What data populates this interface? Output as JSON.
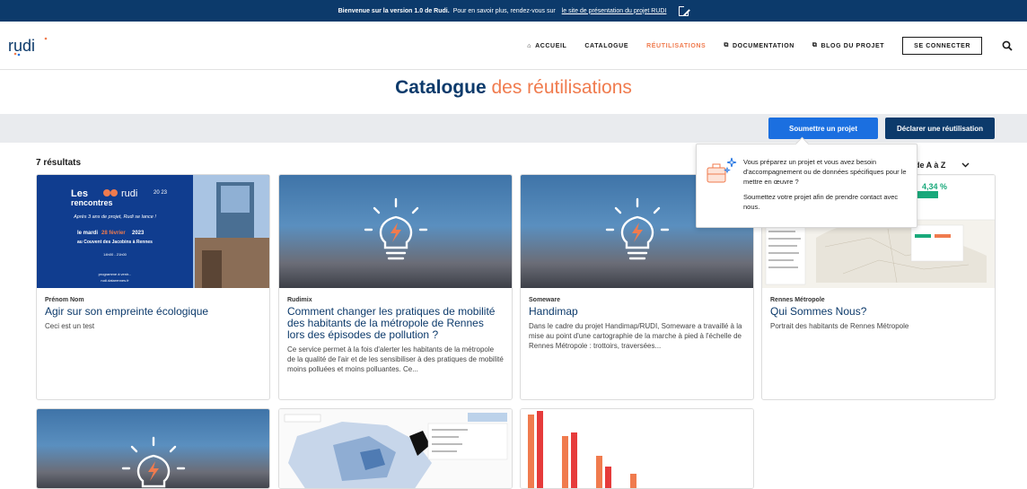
{
  "banner": {
    "bold_text": "Bienvenue sur la version 1.0 de Rudi.",
    "text": "Pour en savoir plus, rendez-vous sur",
    "link_text": "le site de présentation du projet RUDI"
  },
  "nav": {
    "logo_text": "rudi",
    "items": [
      {
        "label": "ACCUEIL",
        "icon": "home-icon"
      },
      {
        "label": "CATALOGUE",
        "icon": ""
      },
      {
        "label": "RÉUTILISATIONS",
        "icon": ""
      },
      {
        "label": "DOCUMENTATION",
        "icon": "external-link-icon"
      },
      {
        "label": "BLOG DU PROJET",
        "icon": "external-link-icon"
      }
    ],
    "login_label": "SE CONNECTER"
  },
  "page": {
    "title_part1": "Catalogue",
    "title_part2": "des réutilisations",
    "submit_button": "Soumettre un projet",
    "declare_button": "Déclarer une réutilisation",
    "results_count": "7 résultats",
    "sort_label": "re de A à Z"
  },
  "popover": {
    "text1": "Vous préparez un projet et vous avez besoin d'accompagnement ou de données spécifiques pour le mettre en œuvre ?",
    "text2": "Soumettez votre projet afin de prendre contact avec nous."
  },
  "cards": [
    {
      "author": "Prénom Nom",
      "title": "Agir sur son empreinte écologique",
      "description": "Ceci est un test",
      "poster": {
        "line1": "Les",
        "line2": "rencontres",
        "brand": "rudi",
        "year": "20 23",
        "sub": "Après 3 ans de projet, Rudi se lance !",
        "date_a": "le mardi",
        "date_b": "28 février",
        "date_c": "2023",
        "place": "au Couvent des Jacobins à Rennes",
        "time": "14h00 - 21h00",
        "prog": "programme à venir...",
        "url": "rudi.datarennes.fr"
      }
    },
    {
      "author": "Rudimix",
      "title": "Comment changer les pratiques de mobilité des habitants de la métropole de Rennes lors des épisodes de pollution ?",
      "description": "Ce service permet à la fois d'alerter les habitants de la métropole de la qualité de l'air et de les sensibiliser à des pratiques de mobilité moins polluées et moins polluantes. Ce..."
    },
    {
      "author": "Someware",
      "title": "Handimap",
      "description": "Dans le cadre du projet Handimap/RUDI, Someware a travaillé à la mise au point d'une cartographie de la marche à pied à l'échelle de Rennes Métropole : trottoirs, traversées..."
    },
    {
      "author": "Rennes Métropole",
      "title": "Qui Sommes Nous?",
      "description": "Portrait des habitants de Rennes Métropole",
      "stat": "4,34 %"
    }
  ],
  "colors": {
    "navy": "#0c3a6b",
    "orange": "#f07b4e",
    "blue": "#1b6fe0",
    "green": "#19a97b"
  }
}
